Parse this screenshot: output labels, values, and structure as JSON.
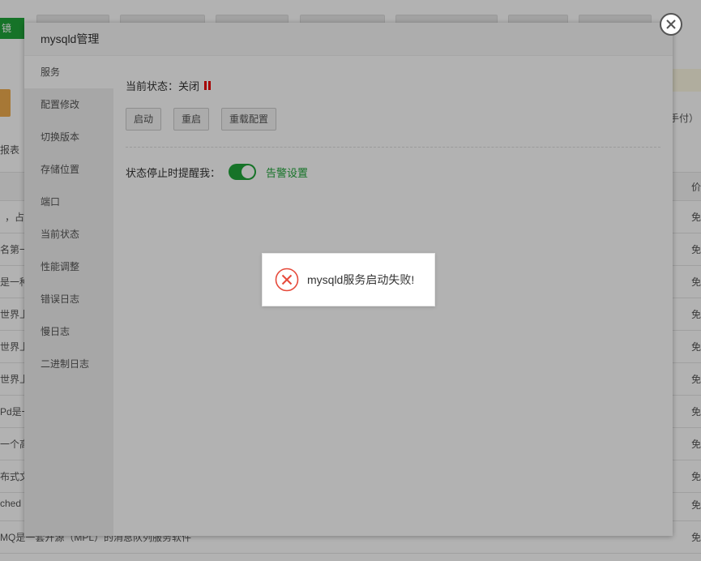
{
  "background": {
    "green_button": "镜",
    "tab_partial": "报表",
    "right_partial": "手付）",
    "header_col": "价",
    "rows": [
      {
        "left": "，占有",
        "right": "免"
      },
      {
        "left": "名第一",
        "right": "免"
      },
      {
        "left": "是一种",
        "right": "免"
      },
      {
        "left": "世界上",
        "right": "免"
      },
      {
        "left": "世界上",
        "right": "免"
      },
      {
        "left": "世界上",
        "right": "免"
      },
      {
        "left": "Pd是一",
        "right": "免"
      },
      {
        "left": "一个高",
        "right": "免"
      },
      {
        "left": "布式文",
        "right": "免"
      },
      {
        "left": "ched",
        "right": "免"
      },
      {
        "left": "MQ是一套开源（MPL）的消息队列服务软件",
        "right": "免"
      }
    ]
  },
  "dialog": {
    "title": "mysqld管理",
    "sidebar": [
      {
        "label": "服务",
        "active": true
      },
      {
        "label": "配置修改"
      },
      {
        "label": "切换版本"
      },
      {
        "label": "存储位置"
      },
      {
        "label": "端口"
      },
      {
        "label": "当前状态"
      },
      {
        "label": "性能调整"
      },
      {
        "label": "错误日志"
      },
      {
        "label": "慢日志"
      },
      {
        "label": "二进制日志"
      }
    ],
    "status_label": "当前状态：",
    "status_value": "关闭",
    "buttons": {
      "start": "启动",
      "restart": "重启",
      "reload": "重载配置"
    },
    "alert_label": "状态停止时提醒我：",
    "alert_toggle_on": true,
    "alert_link": "告警设置"
  },
  "toast": {
    "icon": "error-circle-icon",
    "message": "mysqld服务启动失败!"
  },
  "colors": {
    "brand_green": "#20a53a",
    "error_red": "#e64a3b",
    "status_red": "#ee0000"
  }
}
